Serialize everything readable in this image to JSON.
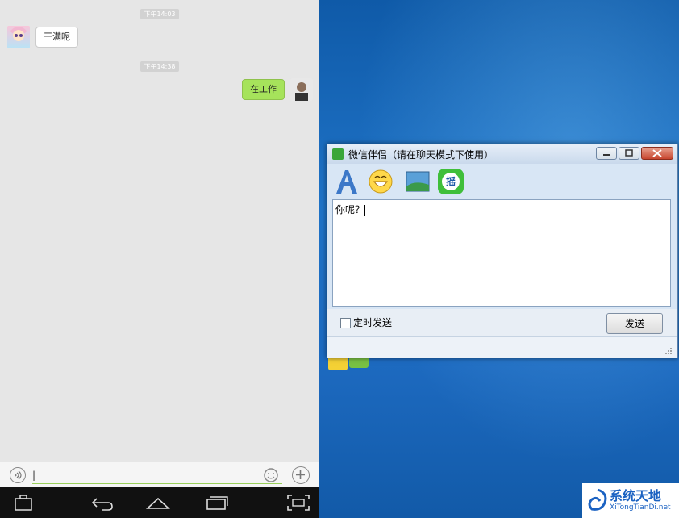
{
  "chat": {
    "time1": "下午14:03",
    "message1": "干满呢",
    "time2": "下午14:38",
    "message2": "在工作"
  },
  "input": {
    "value": "|"
  },
  "dialog": {
    "title": "微信伴侣（请在聊天模式下使用）",
    "editor_text": "你呢？",
    "schedule_label": "定时发送",
    "send_label": "发送",
    "shake_label": "摇"
  },
  "watermark": {
    "title": "系统天地",
    "subtitle": "XiTongTianDi.net"
  },
  "colors": {
    "right_bubble": "#a6e35b",
    "desktop": "#1d6ac0",
    "android_nav": "#111111"
  }
}
